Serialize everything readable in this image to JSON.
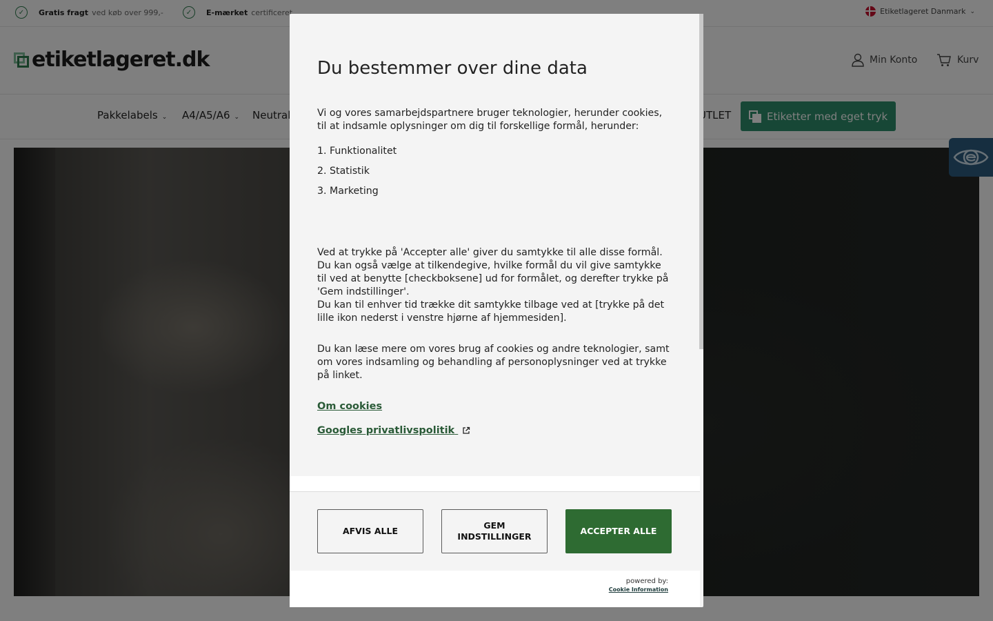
{
  "topbar": {
    "usp1_bold": "Gratis fragt",
    "usp1_text": "ved køb over 999,-",
    "usp2_bold": "E-mærket",
    "usp2_text": "certificeret",
    "country": "Etiketlageret Danmark"
  },
  "header": {
    "logo_text": "etiketlageret.dk",
    "account_label": "Min Konto",
    "cart_label": "Kurv"
  },
  "nav": {
    "items": [
      {
        "label": "Pakkelabels"
      },
      {
        "label": "A4/A5/A6"
      },
      {
        "label": "Neutral"
      },
      {
        "label": "UTLET"
      }
    ],
    "cta_label": "Etiketter med eget tryk"
  },
  "colors": {
    "brand_green": "#2e6b32",
    "cta_green": "#2f8f6c",
    "accessibility_blue": "#2d5d80"
  },
  "modal": {
    "title": "Du bestemmer over dine data",
    "intro": "Vi og vores samarbejdspartnere bruger teknologier, herunder cookies, til at indsamle oplysninger om dig til forskellige formål, herunder:",
    "purposes": [
      "1. Funktionalitet",
      "2. Statistik",
      "3. Marketing"
    ],
    "consent_text_1": "Ved at trykke på 'Accepter alle' giver du samtykke til alle disse formål. Du kan også vælge at tilkendegive, hvilke formål du vil give samtykke til ved at benytte [checkboksene] ud for formålet, og derefter trykke på 'Gem indstillinger'.",
    "consent_text_2": "Du kan til enhver tid trække dit samtykke tilbage ved at [trykke på det lille ikon nederst i venstre hjørne af hjemmesiden].",
    "more_text": "Du kan læse mere om vores brug af cookies og andre teknologier, samt om vores indsamling og behandling af personoplysninger ved at trykke på linket.",
    "link_cookies": "Om cookies",
    "link_google": "Googles privatlivspolitik",
    "btn_reject": "AFVIS ALLE",
    "btn_save": "GEM INDSTILLINGER",
    "btn_accept": "ACCEPTER ALLE",
    "powered_by": "powered by:",
    "powered_name": "Cookie Information"
  }
}
